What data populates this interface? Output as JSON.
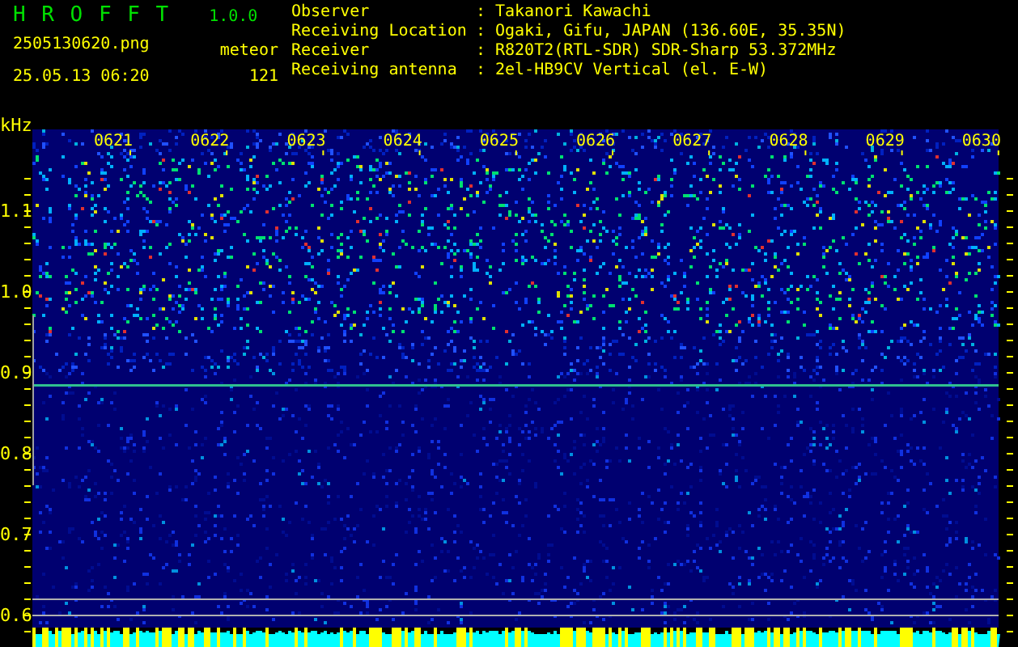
{
  "app": {
    "name": "H R O F F T",
    "version": "1.0.0"
  },
  "file": {
    "filename": "2505130620.png",
    "timestamp": "25.05.13 06:20"
  },
  "meteor": {
    "label": "meteor",
    "count": "121"
  },
  "station": [
    {
      "label": "Observer",
      "separator": ":",
      "value": "Takanori Kawachi"
    },
    {
      "label": "Receiving Location",
      "separator": ":",
      "value": "Ogaki, Gifu, JAPAN (136.60E, 35.35N)"
    },
    {
      "label": "Receiver",
      "separator": ":",
      "value": "R820T2(RTL-SDR) SDR-Sharp 53.372MHz"
    },
    {
      "label": "Receiving antenna",
      "separator": ":",
      "value": "2el-HB9CV Vertical (el. E-W)"
    }
  ],
  "spectrogram": {
    "unit": "kHz",
    "frequency_labels": [
      "1.1",
      "1.0",
      "0.9",
      "0.8",
      "0.7",
      "0.6"
    ],
    "time_labels": [
      "0621",
      "0622",
      "0623",
      "0624",
      "0625",
      "0626",
      "0627",
      "0628",
      "0629",
      "0630"
    ]
  }
}
